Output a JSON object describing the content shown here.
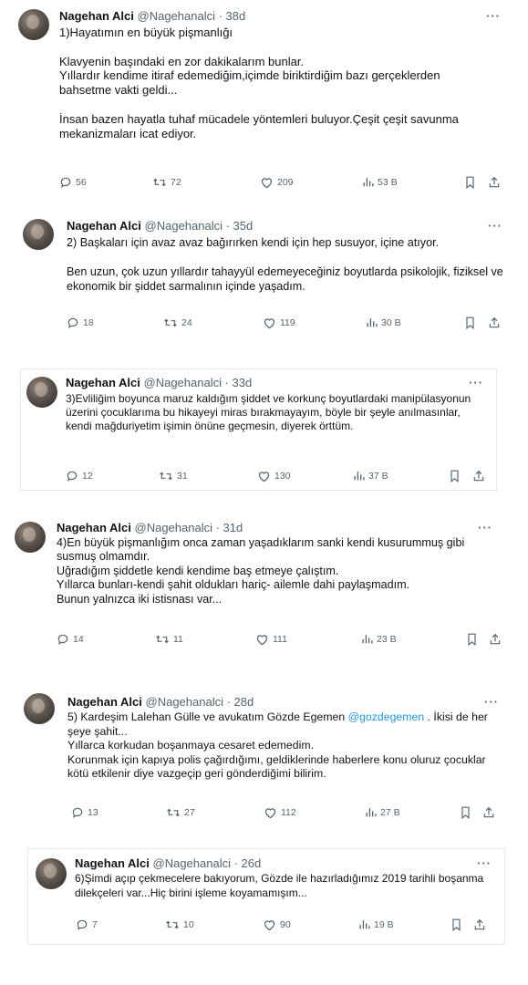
{
  "tweets": [
    {
      "name": "Nagehan Alci",
      "handle": "@Nagehanalci",
      "time": "38d",
      "text": "1)Hayatımın en büyük pişmanlığı\n\nKlavyenin başındaki en zor dakikalarım bunlar.\nYıllardır kendime itiraf edemediğim,içimde biriktirdiğim bazı gerçeklerden bahsetme vakti geldi...\n\nİnsan bazen hayatla tuhaf mücadele yöntemleri buluyor.Çeşit çeşit savunma mekanizmaları icat ediyor.",
      "replies": "56",
      "reposts": "72",
      "likes": "209",
      "views": "53 B"
    },
    {
      "name": "Nagehan Alci",
      "handle": "@Nagehanalci",
      "time": "35d",
      "text": "2) Başkaları için avaz avaz bağırırken kendi için hep susuyor, içine atıyor.\n\nBen uzun, çok uzun yıllardır tahayyül edemeyeceğiniz boyutlarda psikolojik, fiziksel ve ekonomik bir şiddet sarmalının içinde yaşadım.",
      "replies": "18",
      "reposts": "24",
      "likes": "119",
      "views": "30 B"
    },
    {
      "name": "Nagehan Alci",
      "handle": "@Nagehanalci",
      "time": "33d",
      "text": "3)Evliliğim boyunca maruz kaldığım şiddet ve korkunç boyutlardaki manipülasyonun üzerini çocuklarıma bu hikayeyi miras bırakmayayım, böyle bir şeyle anılmasınlar, kendi mağduriyetim işimin önüne geçmesin, diyerek örttüm.",
      "replies": "12",
      "reposts": "31",
      "likes": "130",
      "views": "37 B"
    },
    {
      "name": "Nagehan Alci",
      "handle": "@Nagehanalci",
      "time": "31d",
      "text": "4)En büyük pişmanlığım onca zaman yaşadıklarım sanki kendi kusurummuş gibi susmuş olmamdır.\nUğradığım şiddetle kendi kendime baş etmeye çalıştım.\nYıllarca bunları-kendi şahit oldukları hariç- ailemle dahi paylaşmadım.\nBunun yalnızca iki istisnası var...",
      "replies": "14",
      "reposts": "11",
      "likes": "111",
      "views": "23 B"
    },
    {
      "name": "Nagehan Alci",
      "handle": "@Nagehanalci",
      "time": "28d",
      "text_before": "5) Kardeşim Lalehan Gülle ve avukatım  Gözde Egemen ",
      "mention": "@gozdegemen",
      "text_after": " . İkisi de her şeye şahit...\nYıllarca korkudan boşanmaya cesaret edemedim.\nKorunmak için kapıya polis çağırdığımı, geldiklerinde haberlere konu oluruz çocuklar kötü etkilenir diye vazgeçip geri gönderdiğimi bilirim.",
      "replies": "13",
      "reposts": "27",
      "likes": "112",
      "views": "27 B"
    },
    {
      "name": "Nagehan Alci",
      "handle": "@Nagehanalci",
      "time": "26d",
      "text": "6)Şimdi açıp çekmecelere bakıyorum, Gözde ile hazırladığımız 2019 tarihli boşanma dilekçeleri var...Hiç birini işleme koyamamışım...",
      "replies": "7",
      "reposts": "10",
      "likes": "90",
      "views": "19 B"
    }
  ],
  "separator": " · ",
  "more_glyph": "···",
  "colors": {
    "text": "#0f1419",
    "muted": "#536471",
    "link": "#1d9bf0"
  }
}
